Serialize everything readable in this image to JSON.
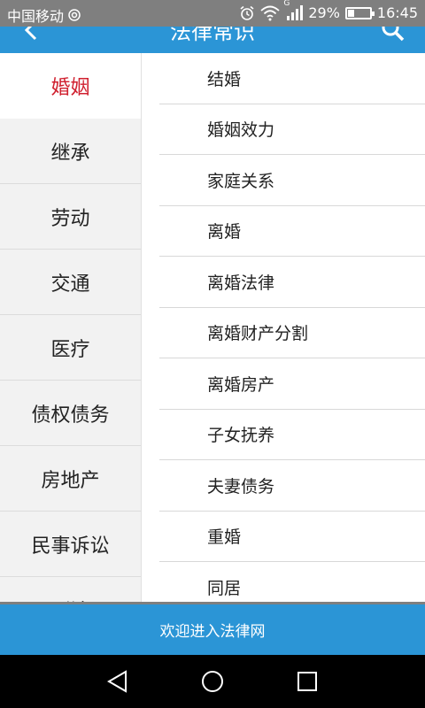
{
  "status_bar": {
    "carrier": "中国移动",
    "battery_text": "29%",
    "battery_level": 0.29,
    "time": "16:45",
    "signal_badge": "G",
    "icons": [
      "nfc-icon",
      "alarm-icon",
      "wifi-icon",
      "signal-icon",
      "battery-icon"
    ]
  },
  "header": {
    "title": "法律常识",
    "back_icon": "back-arrow-icon",
    "search_icon": "search-icon"
  },
  "categories": [
    {
      "label": "婚姻",
      "active": true
    },
    {
      "label": "继承",
      "active": false
    },
    {
      "label": "劳动",
      "active": false
    },
    {
      "label": "交通",
      "active": false
    },
    {
      "label": "医疗",
      "active": false
    },
    {
      "label": "债权债务",
      "active": false
    },
    {
      "label": "房地产",
      "active": false
    },
    {
      "label": "民事诉讼",
      "active": false
    },
    {
      "label": "刑法",
      "active": false
    }
  ],
  "topics": [
    {
      "label": "结婚"
    },
    {
      "label": "婚姻效力"
    },
    {
      "label": "家庭关系"
    },
    {
      "label": "离婚"
    },
    {
      "label": "离婚法律"
    },
    {
      "label": "离婚财产分割"
    },
    {
      "label": "离婚房产"
    },
    {
      "label": "子女抚养"
    },
    {
      "label": "夫妻债务"
    },
    {
      "label": "重婚"
    },
    {
      "label": "同居"
    }
  ],
  "banner": {
    "text": "欢迎进入法律网"
  },
  "colors": {
    "accent": "#2b95d6",
    "active_category": "#d0202f",
    "status_bar": "#7f7f7f"
  }
}
